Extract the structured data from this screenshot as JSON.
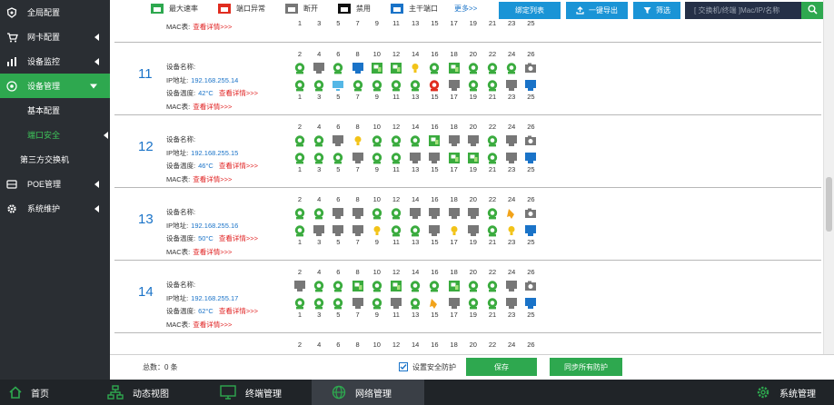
{
  "sidebar": {
    "items": [
      {
        "label": "全局配置",
        "icon": "shield-icon"
      },
      {
        "label": "网卡配置",
        "icon": "cart-icon"
      },
      {
        "label": "设备监控",
        "icon": "bar-chart-icon"
      },
      {
        "label": "设备管理",
        "icon": "gear-circle-icon"
      }
    ],
    "subitems": [
      {
        "label": "基本配置"
      },
      {
        "label": "端口安全"
      },
      {
        "label": "第三方交换机"
      }
    ],
    "items_bottom": [
      {
        "label": "POE管理",
        "icon": "drive-icon"
      },
      {
        "label": "系统维护",
        "icon": "gear-icon"
      }
    ]
  },
  "legend": [
    {
      "label": "最大速率",
      "color": "#2ea84f"
    },
    {
      "label": "端口异常",
      "color": "#e02d20"
    },
    {
      "label": "断开",
      "color": "#777777"
    },
    {
      "label": "禁用",
      "color": "#111111"
    },
    {
      "label": "主干端口",
      "color": "#1a73c8"
    }
  ],
  "more_label": "更多>>",
  "toolbar": {
    "bind_list": "绑定列表",
    "export": "一键导出",
    "filter": "筛选",
    "search_placeholder": "[ 交换机/终端 ]Mac/IP/名称"
  },
  "top_partial": {
    "mac_label": "MAC表:",
    "detail": "查看详情>>>",
    "port_numbers": [
      "1",
      "3",
      "5",
      "7",
      "9",
      "11",
      "13",
      "15",
      "17",
      "19",
      "21",
      "23",
      "25"
    ]
  },
  "field_labels": {
    "name": "设备名称:",
    "ip": "IP地址:",
    "temp": "设备温度:",
    "mac": "MAC表:",
    "detail": "查看详情>>>"
  },
  "switches": [
    {
      "num": "11",
      "ip": "192.168.255.14",
      "temp": "42°C"
    },
    {
      "num": "12",
      "ip": "192.168.255.15",
      "temp": "46°C"
    },
    {
      "num": "13",
      "ip": "192.168.255.16",
      "temp": "50°C"
    },
    {
      "num": "14",
      "ip": "192.168.255.17",
      "temp": "62°C"
    }
  ],
  "ports_even": [
    "2",
    "4",
    "6",
    "8",
    "10",
    "12",
    "14",
    "16",
    "18",
    "20",
    "22",
    "24",
    "26"
  ],
  "ports_odd": [
    "1",
    "3",
    "5",
    "7",
    "9",
    "11",
    "13",
    "15",
    "17",
    "19",
    "21",
    "23",
    "25"
  ],
  "footer": {
    "count_label": "总数：0 条",
    "checkbox_label": "设置安全防护",
    "checkbox_checked": true,
    "save": "保存",
    "sync": "同步所有防护"
  },
  "taskbar": [
    {
      "label": "首页",
      "icon": "home-icon"
    },
    {
      "label": "动态视图",
      "icon": "topology-icon"
    },
    {
      "label": "终端管理",
      "icon": "monitor-icon"
    },
    {
      "label": "网络管理",
      "icon": "globe-icon"
    },
    {
      "label": "系统管理",
      "icon": "gear-icon"
    }
  ]
}
